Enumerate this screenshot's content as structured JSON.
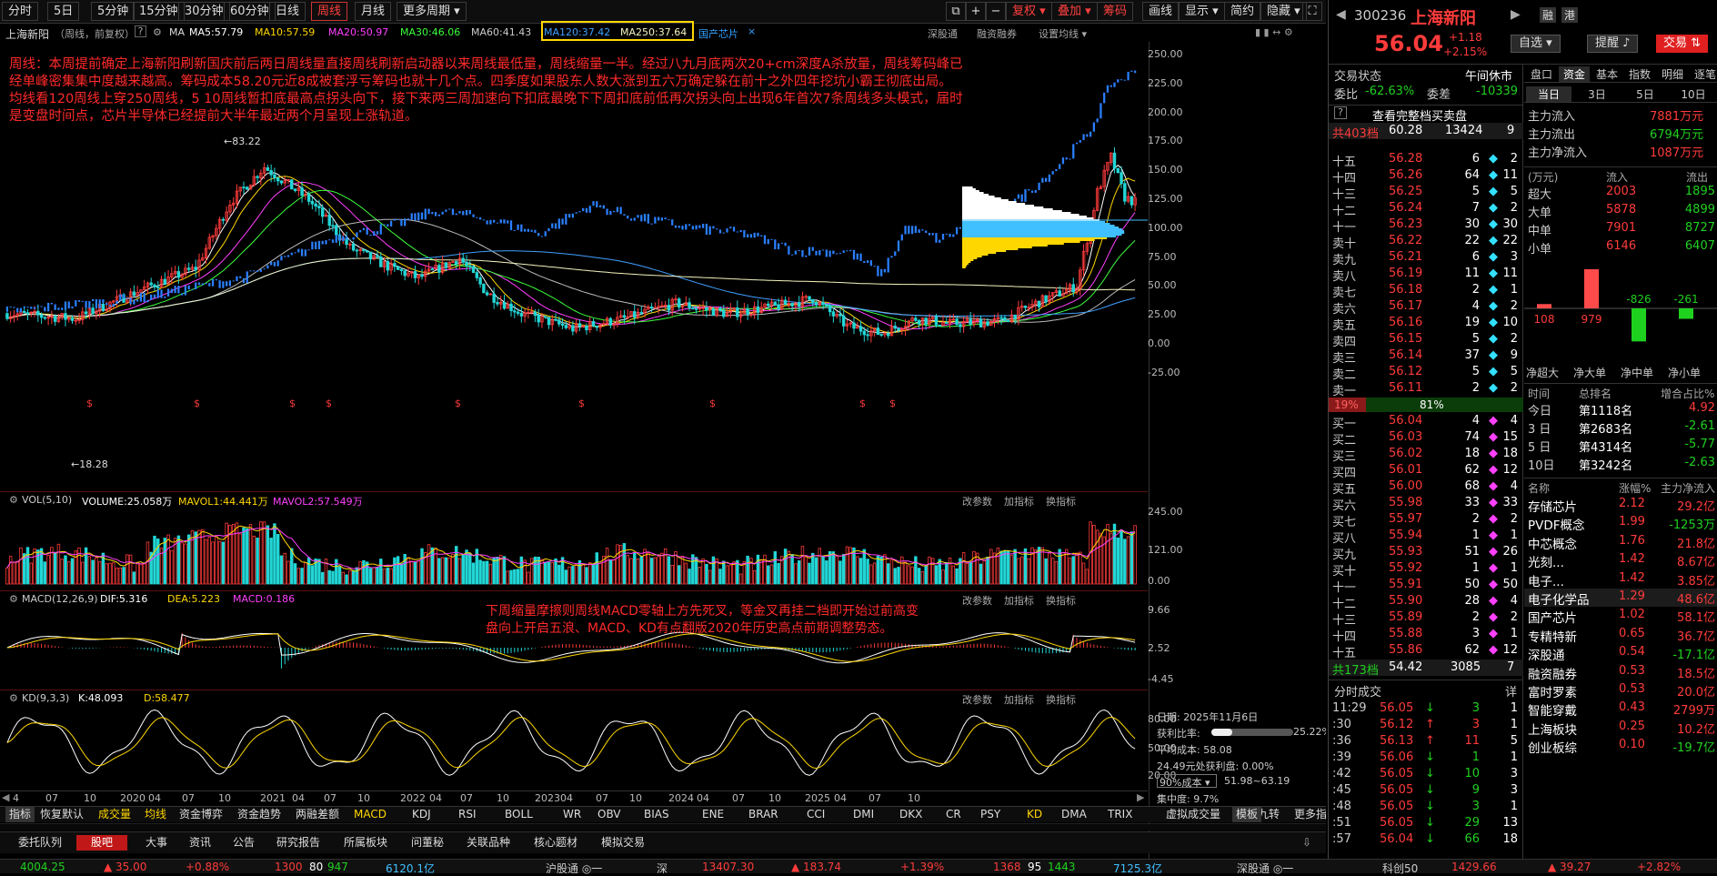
{
  "toolbar": {
    "items": [
      "分时",
      "5日",
      "5分钟",
      "15分钟",
      "30分钟",
      "60分钟",
      "日线",
      "周线",
      "月线",
      "更多周期"
    ],
    "right": [
      "复权",
      "叠加",
      "筹码",
      "画线",
      "显示",
      "简约",
      "隐藏"
    ],
    "icons": [
      "window-icon",
      "plus-icon",
      "minus-icon",
      "lock-icon",
      "expand-icon"
    ]
  },
  "chart_header": {
    "name": "上海新阳",
    "mode": "（周线，前复权）",
    "ma_label": "MA",
    "ma5": "MA5:57.79",
    "ma10": "MA10:57.59",
    "ma20": "MA20:50.97",
    "ma30": "MA30:46.06",
    "ma60": "MA60:41.43",
    "ma120": "MA120:37.42",
    "ma250": "MA250:37.64",
    "concept": "国产芯片",
    "right_links": [
      "深股通",
      "融资融券",
      "设置均线"
    ]
  },
  "annotation_main": [
    "周线：本周提前确定上海新阳刷新国庆前后两日周线量直接周线刷新启动器以来周线最低量，周线缩量一半。经过八九月底两次20+cm深度A杀放量，周线筹码峰已",
    "经单峰密集集中度越来越高。筹码成本58.20元近8成被套浮亏筹码也就十几个点。四季度如果股东人数大涨到五六万确定躲在前十之外四年挖坑小霸王彻底出局。",
    "均线看120周线上穿250周线，5 10周线暂扣底最高点拐头向下，接下来两三周加速向下扣底最晚下下周扣底前低再次拐头向上出现6年首次7条周线多头模式，届时",
    "是变盘时间点，芯片半导体已经提前大半年最近两个月呈现上涨轨道。"
  ],
  "annotation_macd": [
    "下周缩量摩擦则周线MACD零轴上方先死叉，等金叉再挂二档即开始过前高变",
    "盘向上开启五浪、MACD、KD有点翻版2020年历史高点前期调整势态。"
  ],
  "price_axis": [
    "250.00",
    "225.00",
    "200.00",
    "175.00",
    "150.00",
    "125.00",
    "100.00",
    "75.00",
    "50.00",
    "25.00",
    "0.00",
    "-25.00"
  ],
  "price_marks": {
    "high": "83.22",
    "low": "18.28"
  },
  "vol_panel": {
    "title": "VOL(5,10)",
    "volume": "VOLUME:25.058万",
    "mavol1": "MAVOL1:44.441万",
    "mavol2": "MAVOL2:57.549万",
    "axis": [
      "245.00",
      "121.00",
      "0.00"
    ],
    "links": [
      "改参数",
      "加指标",
      "换指标"
    ]
  },
  "macd_panel": {
    "title": "MACD(12,26,9)",
    "dif": "DIF:5.316",
    "dea": "DEA:5.223",
    "macd": "MACD:0.186",
    "axis": [
      "9.66",
      "2.52",
      "-4.45"
    ],
    "links": [
      "改参数",
      "加指标",
      "换指标"
    ]
  },
  "kd_panel": {
    "title": "KD(9,3,3)",
    "k": "K:48.093",
    "d": "D:58.477",
    "axis": [
      "80.00",
      "50.00",
      "20.00"
    ],
    "links": [
      "改参数",
      "加指标",
      "换指标"
    ]
  },
  "time_axis": [
    "4",
    "07",
    "10",
    "2020",
    "04",
    "07",
    "10",
    "2021",
    "04",
    "07",
    "10",
    "2022",
    "04",
    "07",
    "10",
    "2023",
    "04",
    "07",
    "10",
    "2024",
    "04",
    "07",
    "10",
    "2025",
    "04",
    "07",
    "10"
  ],
  "chip_info": {
    "date": "日期: 2025年11月6日",
    "profit_ratio_label": "获利比率:",
    "profit_ratio": "25.22%",
    "profit_ratio_value": 0.2522,
    "avg_cost": "平均成本: 58.08",
    "cost_profit": "24.49元处获利盘: 0.00%",
    "cost_select": "90%成本",
    "cost_range": "51.98~63.19",
    "concentration": "集中度: 9.7%"
  },
  "indicator_tabs": [
    "指标",
    "恢复默认",
    "成交量",
    "均线",
    "资金博弈",
    "资金趋势",
    "两融差额",
    "MACD",
    "KDJ",
    "RSI",
    "BOLL",
    "WR",
    "OBV",
    "BIAS",
    "ENE",
    "BRAR",
    "CCI",
    "DMI",
    "DKX",
    "CR",
    "PSY",
    "KD",
    "DMA",
    "TRIX",
    "虚拟成交量",
    "神奇九转",
    "更多指标",
    "模板"
  ],
  "bottom_tabs": [
    "委托队列",
    "股吧",
    "大事",
    "资讯",
    "公告",
    "研究报告",
    "所属板块",
    "问董秘",
    "关联品种",
    "核心题材",
    "模拟交易"
  ],
  "stock": {
    "code": "300236",
    "name": "上海新阳",
    "tag1": "融",
    "tag2": "港",
    "price": "56.04",
    "change": "+1.18",
    "pct": "+2.15%",
    "btn_watch": "自选",
    "btn_alert": "提醒",
    "btn_trade": "交易"
  },
  "trade_state": {
    "label": "交易状态",
    "value": "午间休市",
    "wb_label": "委比",
    "wb": "-62.63%",
    "wc_label": "委差",
    "wc": "-10339",
    "full": "查看完整档买卖盘"
  },
  "sell_total": {
    "label": "共403档",
    "price": "60.28",
    "vol": "13424",
    "n": "9"
  },
  "sell_orders": [
    [
      "十五",
      "56.28",
      "6",
      "2"
    ],
    [
      "十四",
      "56.26",
      "64",
      "11"
    ],
    [
      "十三",
      "56.25",
      "5",
      "5"
    ],
    [
      "十二",
      "56.24",
      "7",
      "2"
    ],
    [
      "十一",
      "56.23",
      "30",
      "30"
    ],
    [
      "卖十",
      "56.22",
      "22",
      "22"
    ],
    [
      "卖九",
      "56.21",
      "6",
      "3"
    ],
    [
      "卖八",
      "56.19",
      "11",
      "11"
    ],
    [
      "卖七",
      "56.18",
      "2",
      "1"
    ],
    [
      "卖六",
      "56.17",
      "4",
      "2"
    ],
    [
      "卖五",
      "56.16",
      "19",
      "10"
    ],
    [
      "卖四",
      "56.15",
      "5",
      "2"
    ],
    [
      "卖三",
      "56.14",
      "37",
      "9"
    ],
    [
      "卖二",
      "56.12",
      "5",
      "5"
    ],
    [
      "卖一",
      "56.11",
      "2",
      "2"
    ]
  ],
  "ratio": {
    "sell": "19%",
    "buy": "81%",
    "sell_value": 0.19
  },
  "buy_orders": [
    [
      "买一",
      "56.04",
      "4",
      "4"
    ],
    [
      "买二",
      "56.03",
      "74",
      "15"
    ],
    [
      "买三",
      "56.02",
      "18",
      "18"
    ],
    [
      "买四",
      "56.01",
      "62",
      "12"
    ],
    [
      "买五",
      "56.00",
      "68",
      "4"
    ],
    [
      "买六",
      "55.98",
      "33",
      "33"
    ],
    [
      "买七",
      "55.97",
      "2",
      "2"
    ],
    [
      "买八",
      "55.94",
      "1",
      "1"
    ],
    [
      "买九",
      "55.93",
      "51",
      "26"
    ],
    [
      "买十",
      "55.92",
      "1",
      "1"
    ],
    [
      "十一",
      "55.91",
      "50",
      "50"
    ],
    [
      "十二",
      "55.90",
      "28",
      "4"
    ],
    [
      "十三",
      "55.89",
      "2",
      "2"
    ],
    [
      "十四",
      "55.88",
      "3",
      "1"
    ],
    [
      "十五",
      "55.86",
      "62",
      "12"
    ]
  ],
  "buy_total": {
    "label": "共173档",
    "price": "54.42",
    "vol": "3085",
    "n": "7"
  },
  "fenshi": {
    "title": "分时成交",
    "detail": "详",
    "rows": [
      [
        "11:29",
        "56.05",
        "3",
        "1"
      ],
      [
        ":30",
        "56.12",
        "3",
        "1"
      ],
      [
        ":36",
        "56.13",
        "11",
        "5"
      ],
      [
        ":39",
        "56.06",
        "1",
        "1"
      ],
      [
        ":42",
        "56.05",
        "10",
        "3"
      ],
      [
        ":45",
        "56.05",
        "9",
        "3"
      ],
      [
        ":48",
        "56.05",
        "3",
        "1"
      ],
      [
        ":51",
        "56.05",
        "29",
        "13"
      ],
      [
        ":57",
        "56.04",
        "66",
        "18"
      ]
    ]
  },
  "flow_tabs": [
    "盘口",
    "资金",
    "基本",
    "指数",
    "明细",
    "逐笔"
  ],
  "period_tabs": [
    "当日",
    "3日",
    "5日",
    "10日"
  ],
  "main_flow": [
    [
      "主力流入",
      "7881万元"
    ],
    [
      "主力流出",
      "6794万元"
    ],
    [
      "主力净流入",
      "1087万元"
    ]
  ],
  "flow_table": {
    "unit": "(万元)",
    "in": "流入",
    "out": "流出",
    "rows": [
      [
        "超大",
        "2003",
        "1895"
      ],
      [
        "大单",
        "5878",
        "4899"
      ],
      [
        "中单",
        "7901",
        "8727"
      ],
      [
        "小单",
        "6146",
        "6407"
      ]
    ]
  },
  "net_bars": {
    "labels": [
      "净超大",
      "净大单",
      "净中单",
      "净小单"
    ],
    "values": [
      108,
      979,
      -826,
      -261
    ],
    "texts": [
      "108",
      "979",
      "-826",
      "-261"
    ]
  },
  "rank": {
    "headers": [
      "时间",
      "总排名",
      "增合占比%"
    ],
    "rows": [
      [
        "今日",
        "第1118名",
        "4.92"
      ],
      [
        "3 日",
        "第2683名",
        "-2.61"
      ],
      [
        "5 日",
        "第4314名",
        "-5.77"
      ],
      [
        "10日",
        "第3242名",
        "-2.63"
      ]
    ]
  },
  "sectors": {
    "headers": [
      "名称",
      "涨幅%",
      "主力净流入"
    ],
    "rows": [
      [
        "存储芯片",
        "2.12",
        "29.2亿"
      ],
      [
        "PVDF概念",
        "1.99",
        "-1253万"
      ],
      [
        "中芯概念",
        "1.76",
        "21.8亿"
      ],
      [
        "光刻...",
        "1.42",
        "8.67亿"
      ],
      [
        "电子...",
        "1.42",
        "3.85亿"
      ],
      [
        "电子化学品",
        "1.29",
        "48.6亿"
      ],
      [
        "国产芯片",
        "1.02",
        "58.1亿"
      ],
      [
        "专精特新",
        "0.65",
        "36.7亿"
      ],
      [
        "深股通",
        "0.54",
        "-17.1亿"
      ],
      [
        "融资融券",
        "0.53",
        "18.5亿"
      ],
      [
        "富时罗素",
        "0.53",
        "20.0亿"
      ],
      [
        "智能穿戴",
        "0.43",
        "2799万"
      ],
      [
        "上海板块",
        "0.25",
        "10.2亿"
      ],
      [
        "创业板综",
        "0.10",
        "-19.7亿"
      ]
    ]
  },
  "status_bar": {
    "sh": "4004.25",
    "sh_chg": "▲ 35.00",
    "sh_pct": "+0.88%",
    "sh_n1": "1300",
    "sh_n2": "80",
    "sh_n3": "947",
    "sh_amt": "6120.1亿",
    "hgt": "沪股通 ◎一",
    "sz_label": "深",
    "sz": "13407.30",
    "sz_chg": "▲ 183.74",
    "sz_pct": "+1.39%",
    "sz_n1": "1368",
    "sz_n2": "95",
    "sz_n3": "1443",
    "sz_amt": "7125.3亿",
    "sgt": "深股通 ◎一",
    "kc_label": "科创50",
    "kc": "1429.66",
    "kc_chg": "▲ 39.27",
    "kc_pct": "+2.82%"
  }
}
